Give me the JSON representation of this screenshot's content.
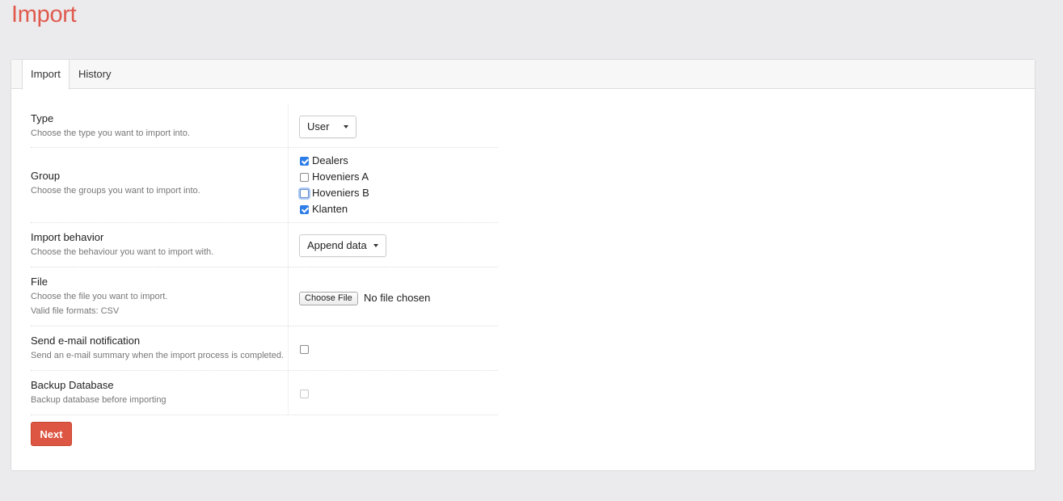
{
  "page": {
    "title": "Import"
  },
  "tabs": [
    {
      "label": "Import",
      "active": true
    },
    {
      "label": "History",
      "active": false
    }
  ],
  "form": {
    "type": {
      "label": "Type",
      "description": "Choose the type you want to import into.",
      "value": "User"
    },
    "group": {
      "label": "Group",
      "description": "Choose the groups you want to import into.",
      "options": [
        {
          "label": "Dealers",
          "checked": true
        },
        {
          "label": "Hoveniers A",
          "checked": false
        },
        {
          "label": "Hoveniers B",
          "checked": false,
          "focused": true
        },
        {
          "label": "Klanten",
          "checked": true
        }
      ]
    },
    "behavior": {
      "label": "Import behavior",
      "description": "Choose the behaviour you want to import with.",
      "value": "Append data"
    },
    "file": {
      "label": "File",
      "description": "Choose the file you want to import.",
      "formats": "Valid file formats: CSV",
      "button": "Choose File",
      "status": "No file chosen"
    },
    "email": {
      "label": "Send e-mail notification",
      "description": "Send an e-mail summary when the import process is completed.",
      "checked": false
    },
    "backup": {
      "label": "Backup Database",
      "description": "Backup database before importing",
      "checked": false,
      "disabled": true
    }
  },
  "actions": {
    "next": "Next"
  },
  "colors": {
    "accent": "#dd5543",
    "checkbox": "#2d7ee8"
  }
}
